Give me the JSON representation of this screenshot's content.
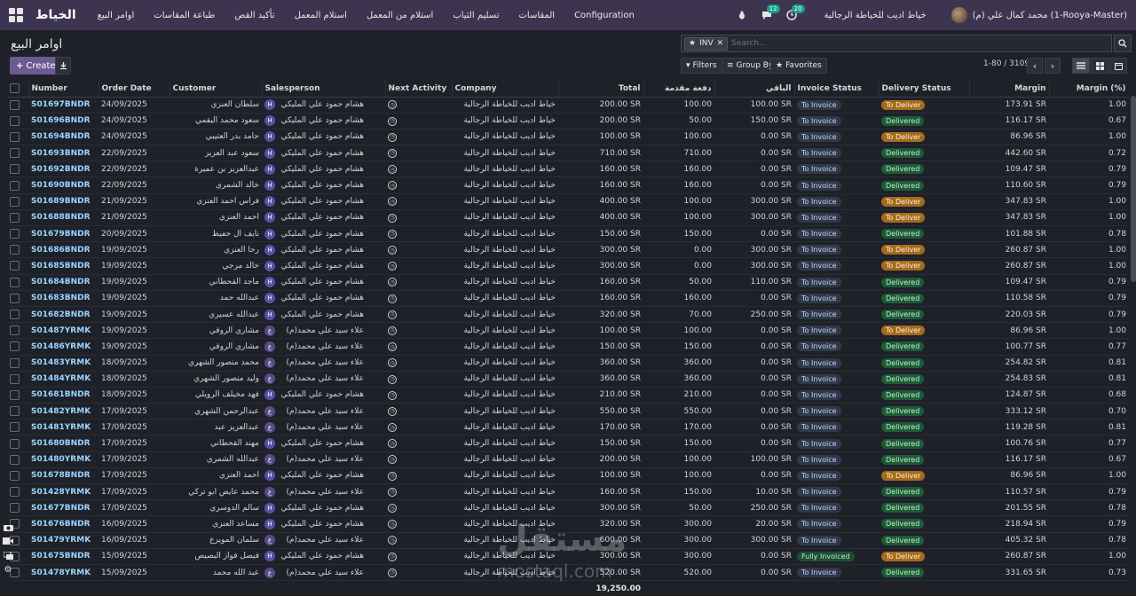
{
  "app": {
    "brand": "الخياط",
    "menu": [
      "اوامر البيع",
      "طباعة المقاسات",
      "تأكيد القص",
      "استلام المعمل",
      "استلام من المعمل",
      "تسليم الثياب",
      "المقاسات",
      "Configuration"
    ],
    "company_switch": "خياط اديب للخياطة الرجالية",
    "user": "محمد كمال علي (م) (1-Rooya-Master)",
    "chat_count": "12",
    "activity_count": "20"
  },
  "control": {
    "title": "اوامر البيع",
    "create_label": "Create",
    "facet_label": "INV",
    "search_placeholder": "Search...",
    "filters_label": "Filters",
    "groupby_label": "Group By",
    "favorites_label": "Favorites",
    "pager": "1-80 / 3109"
  },
  "columns": [
    "Number",
    "Order Date",
    "Customer",
    "Salesperson",
    "Next Activity",
    "Company",
    "Total",
    "دفعة مقدمة",
    "الباقي",
    "Invoice Status",
    "Delivery Status",
    "Margin",
    "Margin (%)"
  ],
  "rows": [
    [
      "S01697BNDR",
      "24/09/2025",
      "سلطان العنزي",
      "H",
      "هشام حمود علي المليكي",
      "خياط اديب للخياطة الرجالية",
      "200.00 SR",
      "100.00",
      "100.00 SR",
      "To Invoice",
      "To Deliver",
      "173.91 SR",
      "1.00"
    ],
    [
      "S01696BNDR",
      "24/09/2025",
      "سعود محمد اليقمي",
      "H",
      "هشام حمود علي المليكي",
      "خياط اديب للخياطة الرجالية",
      "200.00 SR",
      "50.00",
      "150.00 SR",
      "To Invoice",
      "Delivered",
      "116.17 SR",
      "0.67"
    ],
    [
      "S01694BNDR",
      "24/09/2025",
      "حامد بدر العتيبي",
      "H",
      "هشام حمود علي المليكي",
      "خياط اديب للخياطة الرجالية",
      "100.00 SR",
      "100.00",
      "0.00 SR",
      "To Invoice",
      "To Deliver",
      "86.96 SR",
      "1.00"
    ],
    [
      "S01693BNDR",
      "22/09/2025",
      "سعود عبد العزيز",
      "H",
      "هشام حمود علي المليكي",
      "خياط اديب للخياطة الرجالية",
      "710.00 SR",
      "710.00",
      "0.00 SR",
      "To Invoice",
      "Delivered",
      "442.60 SR",
      "0.72"
    ],
    [
      "S01692BNDR",
      "22/09/2025",
      "عبدالعزيز بن عميرة",
      "H",
      "هشام حمود علي المليكي",
      "خياط اديب للخياطة الرجالية",
      "160.00 SR",
      "160.00",
      "0.00 SR",
      "To Invoice",
      "Delivered",
      "109.47 SR",
      "0.79"
    ],
    [
      "S01690BNDR",
      "22/09/2025",
      "خالد الشمري",
      "H",
      "هشام حمود علي المليكي",
      "خياط اديب للخياطة الرجالية",
      "160.00 SR",
      "160.00",
      "0.00 SR",
      "To Invoice",
      "Delivered",
      "110.60 SR",
      "0.79"
    ],
    [
      "S01689BNDR",
      "21/09/2025",
      "فراس احمد العنزي",
      "H",
      "هشام حمود علي المليكي",
      "خياط اديب للخياطة الرجالية",
      "400.00 SR",
      "100.00",
      "300.00 SR",
      "To Invoice",
      "To Deliver",
      "347.83 SR",
      "1.00"
    ],
    [
      "S01688BNDR",
      "21/09/2025",
      "احمد العنزي",
      "H",
      "هشام حمود علي المليكي",
      "خياط اديب للخياطة الرجالية",
      "400.00 SR",
      "100.00",
      "300.00 SR",
      "To Invoice",
      "To Deliver",
      "347.83 SR",
      "1.00"
    ],
    [
      "S01679BNDR",
      "20/09/2025",
      "نايف ال حفيظ",
      "H",
      "هشام حمود علي المليكي",
      "خياط اديب للخياطة الرجالية",
      "150.00 SR",
      "150.00",
      "0.00 SR",
      "To Invoice",
      "Delivered",
      "101.88 SR",
      "0.78"
    ],
    [
      "S01686BNDR",
      "19/09/2025",
      "رحا العنزي",
      "H",
      "هشام حمود علي المليكي",
      "خياط اديب للخياطة الرجالية",
      "300.00 SR",
      "0.00",
      "300.00 SR",
      "To Invoice",
      "To Deliver",
      "260.87 SR",
      "1.00"
    ],
    [
      "S01685BNDR",
      "19/09/2025",
      "خالد مرجي",
      "H",
      "هشام حمود علي المليكي",
      "خياط اديب للخياطة الرجالية",
      "300.00 SR",
      "0.00",
      "300.00 SR",
      "To Invoice",
      "To Deliver",
      "260.87 SR",
      "1.00"
    ],
    [
      "S01684BNDR",
      "19/09/2025",
      "ماجد القحطاني",
      "H",
      "هشام حمود علي المليكي",
      "خياط اديب للخياطة الرجالية",
      "160.00 SR",
      "50.00",
      "110.00 SR",
      "To Invoice",
      "Delivered",
      "109.47 SR",
      "0.79"
    ],
    [
      "S01683BNDR",
      "19/09/2025",
      "عبدالله حمد",
      "H",
      "هشام حمود علي المليكي",
      "خياط اديب للخياطة الرجالية",
      "160.00 SR",
      "160.00",
      "0.00 SR",
      "To Invoice",
      "Delivered",
      "110.58 SR",
      "0.79"
    ],
    [
      "S01682BNDR",
      "19/09/2025",
      "عبدالله عسيري",
      "H",
      "هشام حمود علي المليكي",
      "خياط اديب للخياطة الرجالية",
      "320.00 SR",
      "70.00",
      "250.00 SR",
      "To Invoice",
      "Delivered",
      "220.03 SR",
      "0.79"
    ],
    [
      "S01487YRMK",
      "19/09/2025",
      "مشاري الروقي",
      "ع",
      "علاء سيد علي محمد(م)",
      "خياط اديب للخياطة الرجالية",
      "100.00 SR",
      "100.00",
      "0.00 SR",
      "To Invoice",
      "To Deliver",
      "86.96 SR",
      "1.00"
    ],
    [
      "S01486YRMK",
      "19/09/2025",
      "مشاري الروقي",
      "ع",
      "علاء سيد علي محمد(م)",
      "خياط اديب للخياطة الرجالية",
      "150.00 SR",
      "150.00",
      "0.00 SR",
      "To Invoice",
      "Delivered",
      "100.77 SR",
      "0.77"
    ],
    [
      "S01483YRMK",
      "18/09/2025",
      "محمد منصور الشهري",
      "ع",
      "علاء سيد علي محمد(م)",
      "خياط اديب للخياطة الرجالية",
      "360.00 SR",
      "360.00",
      "0.00 SR",
      "To Invoice",
      "Delivered",
      "254.82 SR",
      "0.81"
    ],
    [
      "S01484YRMK",
      "18/09/2025",
      "وليد منصور الشهري",
      "ع",
      "علاء سيد علي محمد(م)",
      "خياط اديب للخياطة الرجالية",
      "360.00 SR",
      "360.00",
      "0.00 SR",
      "To Invoice",
      "Delivered",
      "254.83 SR",
      "0.81"
    ],
    [
      "S01681BNDR",
      "18/09/2025",
      "فهد مخيلف الرويلي",
      "H",
      "هشام حمود علي المليكي",
      "خياط اديب للخياطة الرجالية",
      "210.00 SR",
      "210.00",
      "0.00 SR",
      "To Invoice",
      "Delivered",
      "124.87 SR",
      "0.68"
    ],
    [
      "S01482YRMK",
      "17/09/2025",
      "عبدالرحمن الشهري",
      "ع",
      "علاء سيد علي محمد(م)",
      "خياط اديب للخياطة الرجالية",
      "550.00 SR",
      "550.00",
      "0.00 SR",
      "To Invoice",
      "Delivered",
      "333.12 SR",
      "0.70"
    ],
    [
      "S01481YRMK",
      "17/09/2025",
      "عبدالعزيز عبد",
      "ع",
      "علاء سيد علي محمد(م)",
      "خياط اديب للخياطة الرجالية",
      "170.00 SR",
      "170.00",
      "0.00 SR",
      "To Invoice",
      "Delivered",
      "119.28 SR",
      "0.81"
    ],
    [
      "S01680BNDR",
      "17/09/2025",
      "مهند القحطاني",
      "H",
      "هشام حمود علي المليكي",
      "خياط اديب للخياطة الرجالية",
      "150.00 SR",
      "150.00",
      "0.00 SR",
      "To Invoice",
      "Delivered",
      "100.76 SR",
      "0.77"
    ],
    [
      "S01480YRMK",
      "17/09/2025",
      "عبدالله الشمري",
      "ع",
      "علاء سيد علي محمد(م)",
      "خياط اديب للخياطة الرجالية",
      "200.00 SR",
      "100.00",
      "100.00 SR",
      "To Invoice",
      "Delivered",
      "116.17 SR",
      "0.67"
    ],
    [
      "S01678BNDR",
      "17/09/2025",
      "احمد العنزي",
      "H",
      "هشام حمود علي المليكي",
      "خياط اديب للخياطة الرجالية",
      "100.00 SR",
      "100.00",
      "0.00 SR",
      "To Invoice",
      "To Deliver",
      "86.96 SR",
      "1.00"
    ],
    [
      "S01428YRMK",
      "17/09/2025",
      "محمد عايض ابو تركي",
      "ع",
      "علاء سيد علي محمد(م)",
      "خياط اديب للخياطة الرجالية",
      "160.00 SR",
      "150.00",
      "10.00 SR",
      "To Invoice",
      "Delivered",
      "110.57 SR",
      "0.79"
    ],
    [
      "S01677BNDR",
      "17/09/2025",
      "سالم الدوسري",
      "H",
      "هشام حمود علي المليكي",
      "خياط اديب للخياطة الرجالية",
      "300.00 SR",
      "50.00",
      "250.00 SR",
      "To Invoice",
      "Delivered",
      "201.55 SR",
      "0.78"
    ],
    [
      "S01676BNDR",
      "16/09/2025",
      "مساعد العنزي",
      "H",
      "هشام حمود علي المليكي",
      "خياط اديب للخياطة الرجالية",
      "320.00 SR",
      "300.00",
      "20.00 SR",
      "To Invoice",
      "Delivered",
      "218.94 SR",
      "0.79"
    ],
    [
      "S01479YRMK",
      "16/09/2025",
      "سلمان المويزع",
      "ع",
      "علاء سيد علي محمد(م)",
      "خياط اديب للخياطة الرجالية",
      "600.00 SR",
      "300.00",
      "300.00 SR",
      "To Invoice",
      "Delivered",
      "405.32 SR",
      "0.78"
    ],
    [
      "S01675BNDR",
      "15/09/2025",
      "فيصل فواز البصيص",
      "H",
      "هشام حمود علي المليكي",
      "خياط اديب للخياطة الرجالية",
      "300.00 SR",
      "300.00",
      "0.00 SR",
      "Fully Invoiced",
      "To Deliver",
      "260.87 SR",
      "1.00"
    ],
    [
      "S01478YRMK",
      "15/09/2025",
      "عبد الله محمد",
      "ع",
      "علاء سيد علي محمد(م)",
      "خياط اديب للخياطة الرجالية",
      "520.00 SR",
      "520.00",
      "0.00 SR",
      "To Invoice",
      "Delivered",
      "331.65 SR",
      "0.73"
    ]
  ],
  "total": "19,250.00",
  "watermark": "مستقل",
  "watermark_url": "mostaql.com"
}
